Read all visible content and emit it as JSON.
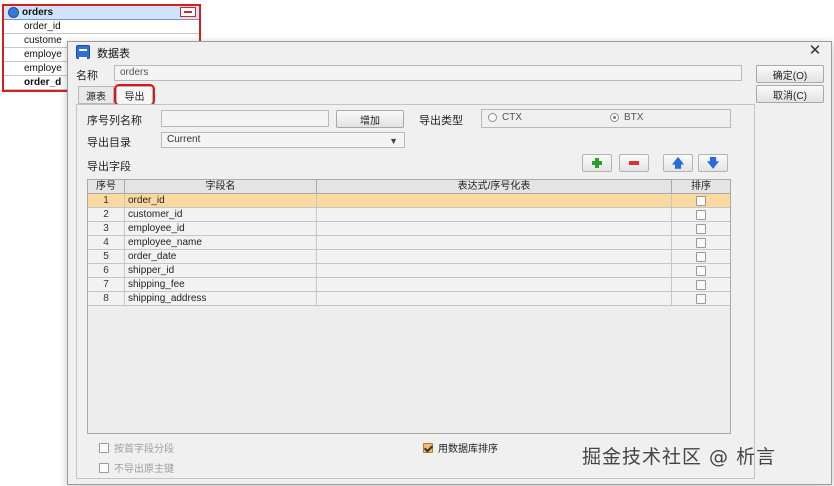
{
  "entity_panel": {
    "title": "orders",
    "rows": [
      {
        "label": "order_id",
        "bold": false
      },
      {
        "label": "custome",
        "bold": false
      },
      {
        "label": "employe",
        "bold": false
      },
      {
        "label": "employe",
        "bold": false
      },
      {
        "label": "order_d",
        "bold": true
      }
    ]
  },
  "dialog": {
    "title": "数据表",
    "close_glyph": "✕",
    "name_label": "名称",
    "name_value": "orders",
    "ok_label": "确定(O)",
    "cancel_label": "取消(C)",
    "tabs": [
      {
        "label": "源表",
        "active": false
      },
      {
        "label": "导出",
        "active": true
      }
    ],
    "seq_col_label": "序号列名称",
    "seq_col_value": "",
    "add_button": "增加",
    "export_type_label": "导出类型",
    "export_types": [
      {
        "label": "CTX",
        "checked": false
      },
      {
        "label": "BTX",
        "checked": true
      }
    ],
    "export_dir_label": "导出目录",
    "export_dir_value": "Current",
    "export_fields_label": "导出字段",
    "toolbar_icons": [
      "plus-icon",
      "minus-icon",
      "arrow-up-icon",
      "arrow-down-icon"
    ],
    "table": {
      "columns": [
        "序号",
        "字段名",
        "表达式/序号化表",
        "排序"
      ],
      "rows": [
        {
          "num": "1",
          "field": "order_id",
          "expr": "",
          "sort": false,
          "selected": true
        },
        {
          "num": "2",
          "field": "customer_id",
          "expr": "",
          "sort": false,
          "selected": false
        },
        {
          "num": "3",
          "field": "employee_id",
          "expr": "",
          "sort": false,
          "selected": false
        },
        {
          "num": "4",
          "field": "employee_name",
          "expr": "",
          "sort": false,
          "selected": false
        },
        {
          "num": "5",
          "field": "order_date",
          "expr": "",
          "sort": false,
          "selected": false
        },
        {
          "num": "6",
          "field": "shipper_id",
          "expr": "",
          "sort": false,
          "selected": false
        },
        {
          "num": "7",
          "field": "shipping_fee",
          "expr": "",
          "sort": false,
          "selected": false
        },
        {
          "num": "8",
          "field": "shipping_address",
          "expr": "",
          "sort": false,
          "selected": false
        }
      ]
    },
    "check_segment_first_field": {
      "label": "按首字段分段",
      "checked": false,
      "enabled": false
    },
    "check_no_primary_key": {
      "label": "不导出原主键",
      "checked": false,
      "enabled": false
    },
    "check_db_sort": {
      "label": "用数据库排序",
      "checked": true,
      "enabled": true
    }
  },
  "watermark": "掘金技术社区 @ 析言",
  "colors": {
    "highlight_red": "#e01616",
    "selected_row": "#fdd9a2",
    "header_blue": "#cfe3fb"
  }
}
